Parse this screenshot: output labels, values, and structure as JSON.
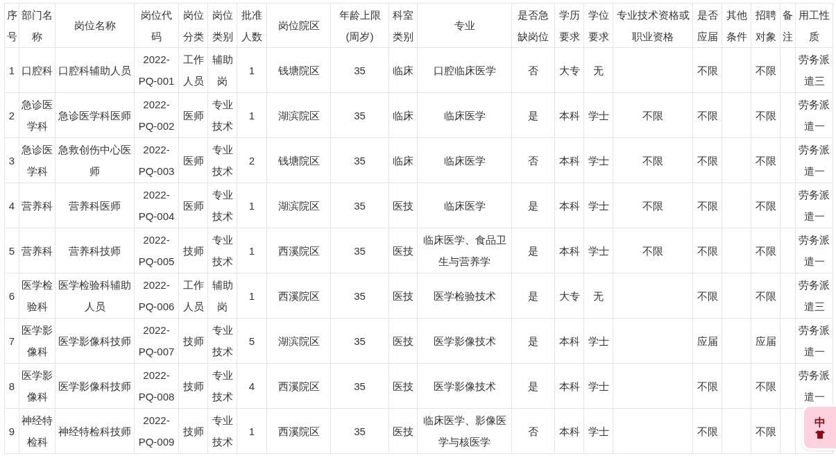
{
  "table": {
    "columns": [
      "序号",
      "部门名称",
      "岗位名称",
      "岗位代码",
      "岗位分类",
      "岗位类别",
      "批准人数",
      "岗位院区",
      "年龄上限(周岁)",
      "科室类别",
      "专业",
      "是否急缺岗位",
      "学历要求",
      "学位要求",
      "专业技术资格或职业资格",
      "是否应届",
      "其他条件",
      "招聘对象",
      "备注",
      "用工性质"
    ],
    "rows": [
      [
        "1",
        "口腔科",
        "口腔科辅助人员",
        "2022-PQ-001",
        "工作人员",
        "辅助岗",
        "1",
        "钱塘院区",
        "35",
        "临床",
        "口腔临床医学",
        "否",
        "大专",
        "无",
        null,
        "不限",
        null,
        "不限",
        null,
        "劳务派遣三"
      ],
      [
        "2",
        "急诊医学科",
        "急诊医学科医师",
        "2022-PQ-002",
        "医师",
        "专业技术",
        "1",
        "湖滨院区",
        "35",
        "临床",
        "临床医学",
        "是",
        "本科",
        "学士",
        "不限",
        "不限",
        null,
        "不限",
        null,
        "劳务派遣一"
      ],
      [
        "3",
        "急诊医学科",
        "急救创伤中心医师",
        "2022-PQ-003",
        "医师",
        "专业技术",
        "2",
        "钱塘院区",
        "35",
        "临床",
        "临床医学",
        "否",
        "本科",
        "学士",
        "不限",
        "不限",
        null,
        "不限",
        null,
        "劳务派遣一"
      ],
      [
        "4",
        "营养科",
        "营养科医师",
        "2022-PQ-004",
        "医师",
        "专业技术",
        "1",
        "湖滨院区",
        "35",
        "医技",
        "临床医学",
        "是",
        "本科",
        "学士",
        "不限",
        "不限",
        null,
        "不限",
        null,
        "劳务派遣一"
      ],
      [
        "5",
        "营养科",
        "营养科技师",
        "2022-PQ-005",
        "技师",
        "专业技术",
        "1",
        "西溪院区",
        "35",
        "医技",
        "临床医学、食品卫生与营养学",
        "是",
        "本科",
        "学士",
        "不限",
        "不限",
        null,
        "不限",
        null,
        "劳务派遣一"
      ],
      [
        "6",
        "医学检验科",
        "医学检验科辅助人员",
        "2022-PQ-006",
        "工作人员",
        "辅助岗",
        "1",
        "西溪院区",
        "35",
        "医技",
        "医学检验技术",
        "是",
        "大专",
        "无",
        null,
        "不限",
        null,
        "不限",
        null,
        "劳务派遣三"
      ],
      [
        "7",
        "医学影像科",
        "医学影像科技师",
        "2022-PQ-007",
        "技师",
        "专业技术",
        "5",
        "湖滨院区",
        "35",
        "医技",
        "医学影像技术",
        "是",
        "本科",
        "学士",
        null,
        "应届",
        null,
        "应届",
        null,
        "劳务派遣一"
      ],
      [
        "8",
        "医学影像科",
        "医学影像科技师",
        "2022-PQ-008",
        "技师",
        "专业技术",
        "4",
        "西溪院区",
        "35",
        "医技",
        "医学影像技术",
        "是",
        "本科",
        "学士",
        null,
        "不限",
        null,
        "不限",
        null,
        "劳务派遣一"
      ],
      [
        "9",
        "神经特检科",
        "神经特检科技师",
        "2022-PQ-009",
        "技师",
        "专业技术",
        "1",
        "西溪院区",
        "35",
        "医技",
        "临床医学、影像医学与核医学",
        "否",
        "本科",
        "学士",
        null,
        "不限",
        null,
        "不限",
        null,
        null
      ]
    ]
  },
  "ime_toolbar": {
    "mode": "中"
  }
}
